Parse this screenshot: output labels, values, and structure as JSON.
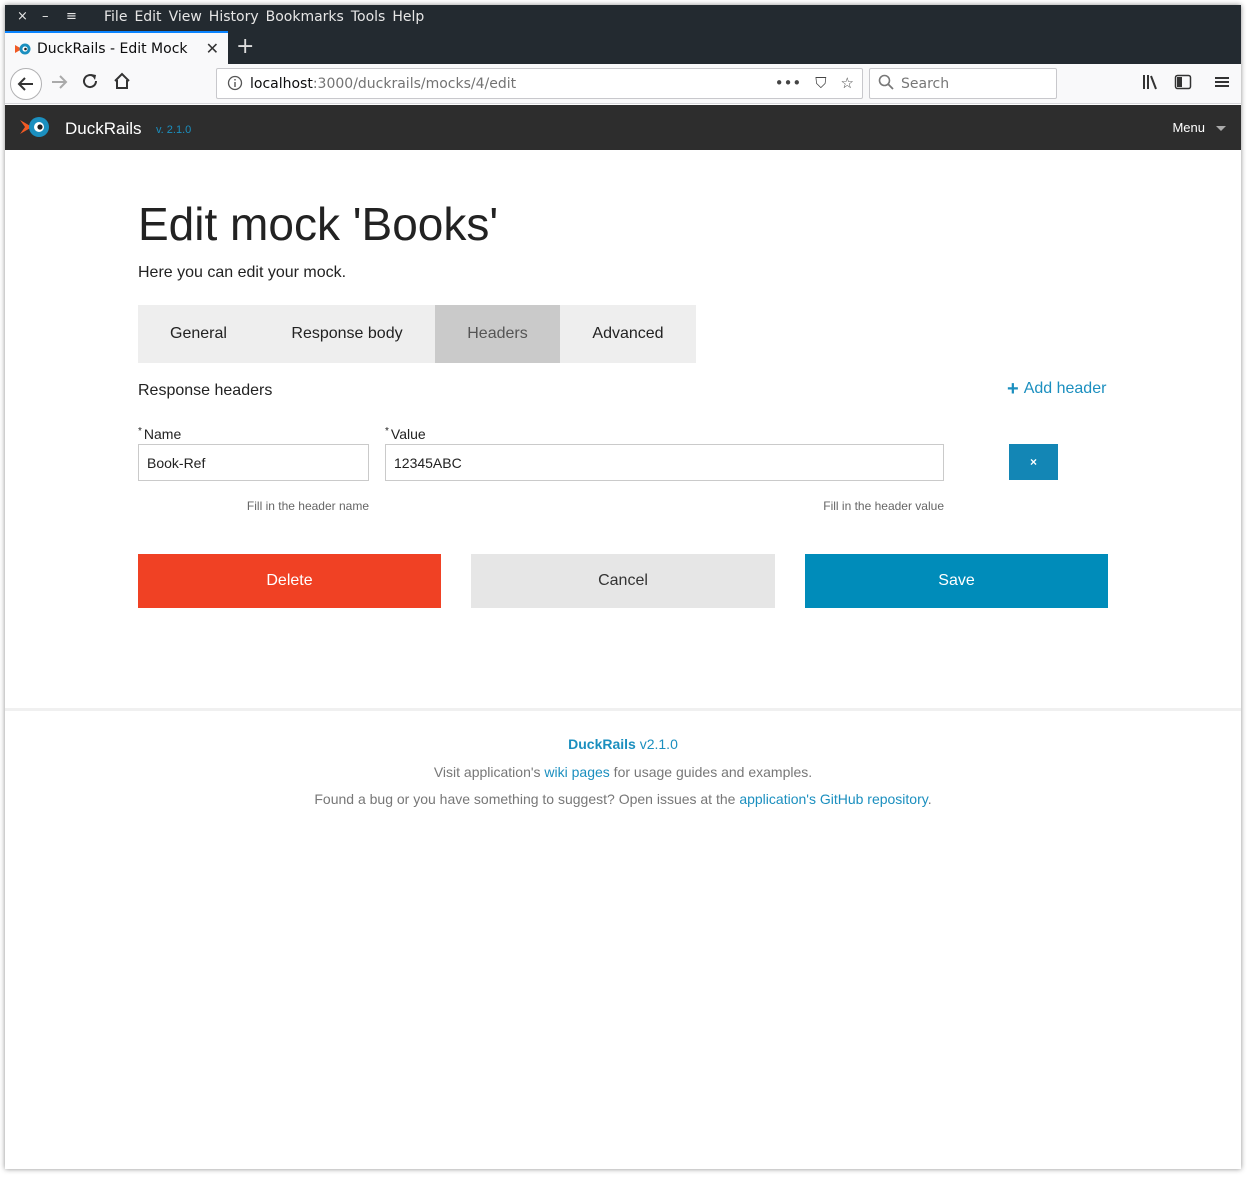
{
  "browser": {
    "window_controls": [
      "×",
      "–",
      "≡"
    ],
    "menu": [
      "File",
      "Edit",
      "View",
      "History",
      "Bookmarks",
      "Tools",
      "Help"
    ],
    "tab_title": "DuckRails - Edit Mock",
    "tab_close": "✕",
    "new_tab": "+",
    "url_host": "localhost",
    "url_rest": ":3000/duckrails/mocks/4/edit",
    "url_actions": [
      "•••",
      "⛉",
      "☆"
    ],
    "search_placeholder": "Search",
    "colors": {
      "accent": "#0a84ff",
      "chrome": "#232a30"
    }
  },
  "app": {
    "name": "DuckRails",
    "version": "v. 2.1.0",
    "menu_label": "Menu",
    "colors": {
      "brand": "#1b8fbf",
      "nav_bg": "#2d2d2d"
    }
  },
  "page": {
    "title": "Edit mock 'Books'",
    "subtitle": "Here you can edit your mock."
  },
  "tabs": [
    {
      "label": "General",
      "active": false
    },
    {
      "label": "Response body",
      "active": false
    },
    {
      "label": "Headers",
      "active": true
    },
    {
      "label": "Advanced",
      "active": false
    }
  ],
  "headers_section": {
    "label": "Response headers",
    "add_label": "Add header",
    "required_mark": "*",
    "name_label": "Name",
    "name_value": "Book-Ref",
    "name_help": "Fill in the header name",
    "value_label": "Value",
    "value_value": "12345ABC",
    "value_help": "Fill in the header value",
    "remove_icon": "×"
  },
  "actions": {
    "delete_label": "Delete",
    "cancel_label": "Cancel",
    "save_label": "Save",
    "colors": {
      "delete": "#f04124",
      "cancel": "#e6e6e6",
      "save": "#008cba"
    }
  },
  "footer": {
    "brand": "DuckRails",
    "version": "v2.1.0",
    "line1_pre": "Visit application's ",
    "line1_link": "wiki pages",
    "line1_post": " for usage guides and examples.",
    "line2_pre": "Found a bug or you have something to suggest? Open issues at the ",
    "line2_link": "application's GitHub repository",
    "line2_post": "."
  }
}
